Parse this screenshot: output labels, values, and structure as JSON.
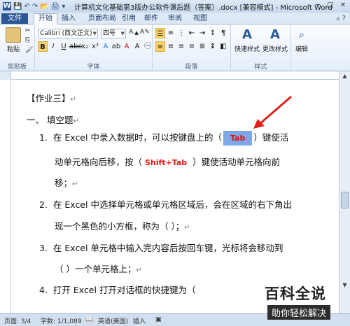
{
  "window": {
    "title": "计算机文化基础第3版办公软件课后题（答案）.docx [兼容模式] - Microsoft Word"
  },
  "tabs": {
    "file": "文件",
    "items": [
      "开始",
      "插入",
      "页面布局",
      "引用",
      "邮件",
      "审阅",
      "视图"
    ]
  },
  "ribbon": {
    "clipboard": {
      "paste": "粘贴",
      "group": "剪贴板"
    },
    "font": {
      "name": "Calibri (西文正文)",
      "size": "四号",
      "group": "字体"
    },
    "paragraph": {
      "group": "段落"
    },
    "styles": {
      "quick": "快速样式",
      "change": "更改样式",
      "group": "样式"
    },
    "edit": {
      "label": "编辑"
    }
  },
  "document": {
    "heading": "【作业三】",
    "section": "一、   填空题",
    "q1": {
      "num": "1.",
      "pre": "在 Excel 中录入数据时，可以按键盘上的（",
      "answer": "Tab",
      "post": "）键使活",
      "line2_pre": "动单元格向后移，按（",
      "answer2": "Shift+Tab",
      "line2_post": "）键使活动单元格向前",
      "line3": "移；"
    },
    "q2": {
      "num": "2.",
      "line1": "在 Excel 中选择单元格或单元格区域后，会在区域的右下角出",
      "line2": "现一个黑色的小方框，称为（        ）；"
    },
    "q3": {
      "num": "3.",
      "line1": "在 Excel 单元格中输入完内容后按回车键，光标将会移动到",
      "line2": "（          ）一个单元格上；"
    },
    "q4": {
      "num": "4.",
      "line1": "打开 Excel 打开对话框的快捷键为（"
    },
    "para_mark": "↵"
  },
  "status": {
    "page": "页面: 3/4",
    "words": "字数: 1/1,089",
    "lang": "英语(美国)",
    "insert": "插入"
  },
  "watermark": {
    "title": "百科全说",
    "subtitle": "助你轻松解决"
  },
  "colors": {
    "file_tab": "#2b5797",
    "highlight": "#7ea7e6",
    "answer_red": "#e11111"
  }
}
